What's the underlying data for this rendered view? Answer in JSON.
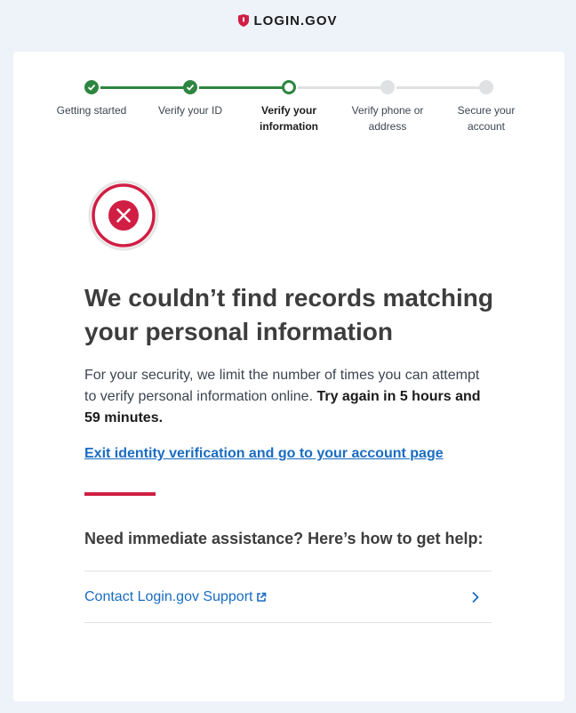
{
  "banner": {
    "logo_text": "LOGIN.GOV"
  },
  "steps": [
    {
      "label": "Getting started",
      "status": "complete"
    },
    {
      "label": "Verify your ID",
      "status": "complete"
    },
    {
      "label": "Verify your information",
      "status": "current"
    },
    {
      "label": "Verify phone or address",
      "status": "upcoming"
    },
    {
      "label": "Secure your account",
      "status": "upcoming"
    }
  ],
  "error": {
    "heading": "We couldn’t find records matching your personal information",
    "body_intro": "For your security, we limit the number of times you can attempt to verify personal information online. ",
    "body_bold": "Try again in 5 hours and 59 minutes.",
    "exit_link": "Exit identity verification and go to your account page"
  },
  "help": {
    "heading": "Need immediate assistance? Here’s how to get help:",
    "support_link": "Contact Login.gov Support"
  },
  "colors": {
    "brand_red": "#d01e44",
    "success_green": "#2e8540",
    "link_blue": "#1a6cc2",
    "page_bg": "#eef3fa"
  }
}
